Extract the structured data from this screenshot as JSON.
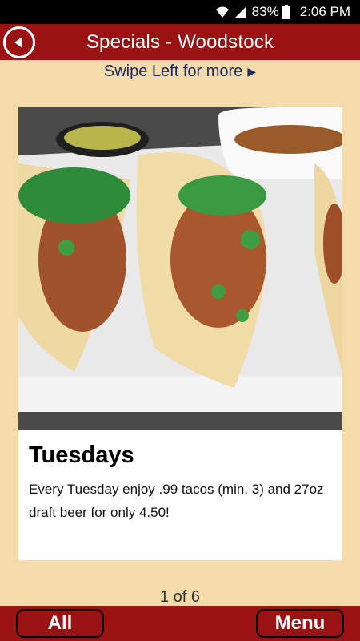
{
  "status_bar": {
    "battery_percent": "83%",
    "time": "2:06 PM",
    "icons": [
      "wifi-icon",
      "signal-icon",
      "battery-icon"
    ]
  },
  "header": {
    "title": "Specials - Woodstock",
    "back_icon": "back-arrow-icon"
  },
  "swipe_hint": {
    "text": "Swipe Left for more",
    "arrow_icon": "triangle-right-icon"
  },
  "special": {
    "title": "Tuesdays",
    "description": "Every Tuesday enjoy .99 tacos (min. 3) and 27oz draft beer for only 4.50!",
    "image": "tacos-photo"
  },
  "pager": {
    "text": "1 of 6"
  },
  "bottom_bar": {
    "all_label": "All",
    "menu_label": "Menu"
  },
  "colors": {
    "brand_red": "#9b1212",
    "background": "#f3dbaa",
    "hint_text": "#1f2a63"
  }
}
